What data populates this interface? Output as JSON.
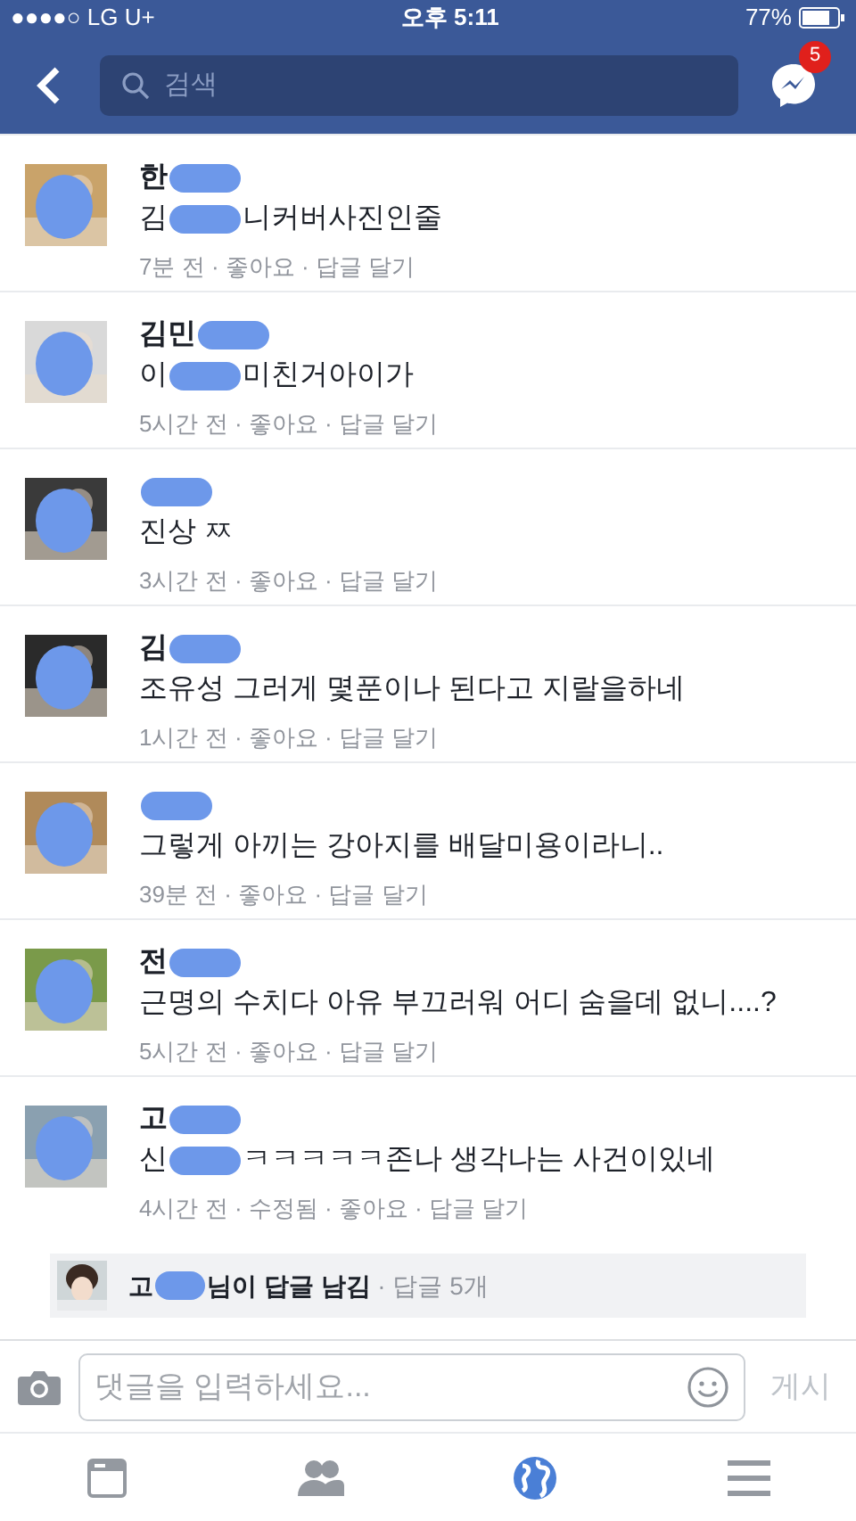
{
  "status_bar": {
    "carrier": "●●●●○ LG U+",
    "time": "오후 5:11",
    "battery": "77%"
  },
  "header": {
    "search": {
      "placeholder": "검색"
    },
    "messenger_badge": "5"
  },
  "comments": [
    {
      "name": "한",
      "text": [
        "김",
        "니커버사진인줄"
      ],
      "meta": "7분 전 · 좋아요 · 답글 달기"
    },
    {
      "name": "김민",
      "text": [
        "이",
        "미친거아이가"
      ],
      "meta": "5시간 전 · 좋아요 · 답글 달기"
    },
    {
      "text": [
        "진상 ㅉ"
      ],
      "meta": "3시간 전 · 좋아요 · 답글 달기"
    },
    {
      "name": "김",
      "text": [
        "조유성 그러게 몇푼이나  된다고 지랄을하네"
      ],
      "meta": "1시간 전 · 좋아요 · 답글 달기"
    },
    {
      "text": [
        "그렇게 아끼는 강아지를 배달미용이라니.."
      ],
      "meta": "39분 전 · 좋아요 · 답글 달기"
    },
    {
      "name": "전",
      "text": [
        "근명의 수치다 아유 부끄러워 어디 숨을데 없니....?"
      ],
      "meta": "5시간 전 · 좋아요 · 답글 달기"
    },
    {
      "name": "고",
      "text": [
        "신",
        "ㅋㅋㅋㅋㅋ존나 생각나는 사건이있네"
      ],
      "meta": "4시간 전 · 수정됨 · 좋아요 · 답글 달기"
    }
  ],
  "reply_summary": {
    "name_start": "고",
    "text": "님이 답글 남김",
    "count": " · 답글 5개"
  },
  "composer": {
    "placeholder": "댓글을 입력하세요...",
    "post_button": "게시"
  },
  "tab_bar": [
    {
      "kind": "feed",
      "selected": false
    },
    {
      "kind": "friends",
      "selected": false
    },
    {
      "kind": "globe",
      "selected": true
    },
    {
      "kind": "menu",
      "selected": false
    }
  ]
}
